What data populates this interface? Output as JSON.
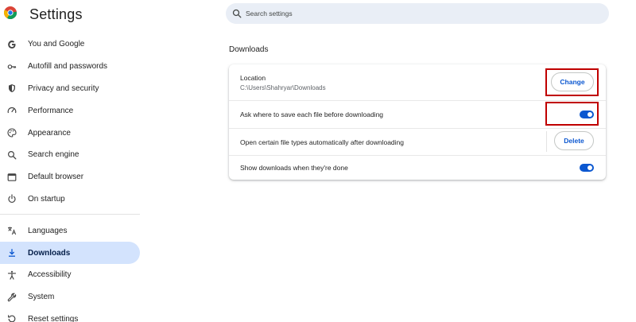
{
  "header": {
    "title": "Settings",
    "search_placeholder": "Search settings"
  },
  "sidebar": {
    "items": [
      {
        "label": "You and Google",
        "icon": "google-g-icon"
      },
      {
        "label": "Autofill and passwords",
        "icon": "key-icon"
      },
      {
        "label": "Privacy and security",
        "icon": "shield-icon"
      },
      {
        "label": "Performance",
        "icon": "speedometer-icon"
      },
      {
        "label": "Appearance",
        "icon": "palette-icon"
      },
      {
        "label": "Search engine",
        "icon": "search-icon"
      },
      {
        "label": "Default browser",
        "icon": "browser-window-icon"
      },
      {
        "label": "On startup",
        "icon": "power-icon"
      },
      {
        "label": "Languages",
        "icon": "translate-icon"
      },
      {
        "label": "Downloads",
        "icon": "download-icon",
        "active": true
      },
      {
        "label": "Accessibility",
        "icon": "accessibility-icon"
      },
      {
        "label": "System",
        "icon": "wrench-icon"
      },
      {
        "label": "Reset settings",
        "icon": "reset-icon"
      }
    ]
  },
  "downloads": {
    "section_title": "Downloads",
    "location_label": "Location",
    "location_path": "C:\\Users\\Shahryar\\Downloads",
    "change_button": "Change",
    "ask_label": "Ask where to save each file before downloading",
    "ask_enabled": true,
    "open_types_label": "Open certain file types automatically after downloading",
    "delete_button": "Delete",
    "show_label": "Show downloads when they're done",
    "show_enabled": true
  },
  "colors": {
    "accent": "#0b57d0",
    "active_nav_bg": "#d3e3fd",
    "search_bg": "#e9eef6",
    "highlight": "#c00000"
  }
}
